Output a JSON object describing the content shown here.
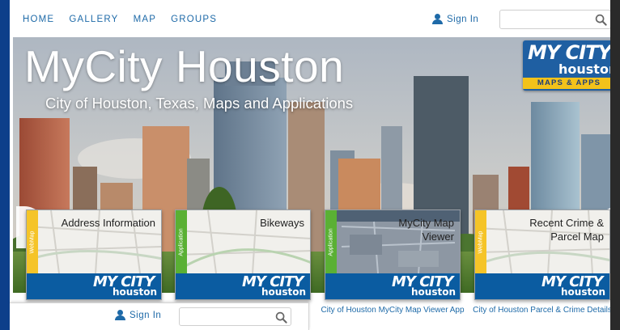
{
  "nav": {
    "links": [
      "HOME",
      "GALLERY",
      "MAP",
      "GROUPS"
    ],
    "sign_in": "Sign In",
    "search_placeholder": ""
  },
  "hero": {
    "title": "MyCity Houston",
    "subtitle": "City of Houston, Texas, Maps and Applications",
    "logo": {
      "line1": "MY CITY",
      "line2": "houston",
      "tagline": "MAPS & APPS"
    }
  },
  "carousel": {
    "prev_icon": "«",
    "next_icon": "»",
    "cards": [
      {
        "title": "Address Information",
        "type_label": "WebMap",
        "footer_my": "MY CITY",
        "footer_houston": "houston"
      },
      {
        "title": "Bikeways",
        "type_label": "Application",
        "footer_my": "MY CITY",
        "footer_houston": "houston"
      },
      {
        "title": "MyCity Map Viewer",
        "type_label": "Application",
        "footer_my": "MY CITY",
        "footer_houston": "houston"
      },
      {
        "title": "Recent Crime & Parcel Map",
        "type_label": "WebMap",
        "footer_my": "MY CITY",
        "footer_houston": "houston"
      }
    ],
    "captions": [
      "City of Houston MyCity Map Viewer App",
      "City of Houston Parcel & Crime Details"
    ]
  },
  "overlay": {
    "sign_in": "Sign In",
    "search_placeholder": ""
  },
  "colors": {
    "link": "#1e6aa8",
    "frame": "#0d3f8a",
    "card_footer": "#0b5ca1",
    "webmap_strip": "#f5c428",
    "app_strip": "#5ab034"
  }
}
